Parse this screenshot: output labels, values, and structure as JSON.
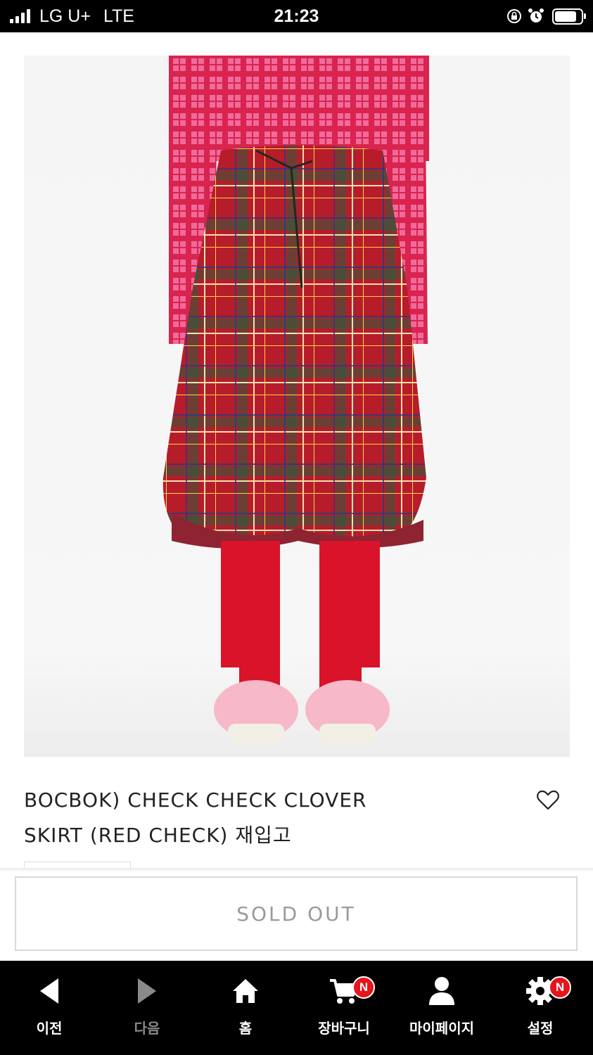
{
  "status_bar": {
    "carrier": "LG U+",
    "network": "LTE",
    "time": "21:23"
  },
  "product": {
    "title_line1": "BOCBOK) CHECK CHECK CLOVER",
    "title_line2": "SKIRT (RED CHECK) 재입고",
    "sold_out_label": "SOLD OUT",
    "image_icon": "plaid-skirt-photo"
  },
  "toolbar": {
    "items": [
      {
        "label": "이전",
        "icon": "back-arrow-icon"
      },
      {
        "label": "다음",
        "icon": "forward-arrow-icon"
      },
      {
        "label": "홈",
        "icon": "home-icon"
      },
      {
        "label": "장바구니",
        "icon": "cart-icon",
        "badge": "N"
      },
      {
        "label": "마이페이지",
        "icon": "user-icon"
      },
      {
        "label": "설정",
        "icon": "gear-icon",
        "badge": "N"
      }
    ]
  },
  "colors": {
    "accent_badge": "#e6151b",
    "toolbar_bg": "#000000",
    "sold_out_text": "#9a9a9a"
  }
}
